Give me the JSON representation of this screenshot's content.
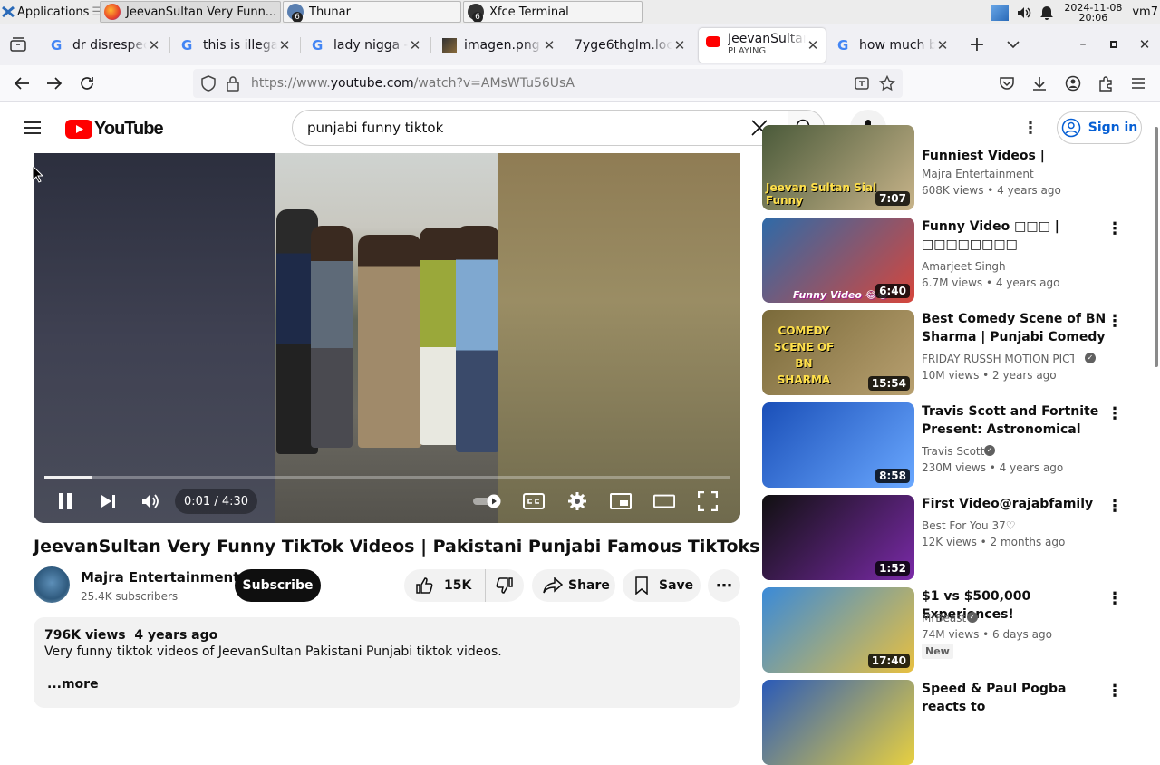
{
  "taskbar": {
    "apps_label": "Applications",
    "windows": [
      "JeevanSultan Very Funn...",
      "Thunar",
      "Xfce Terminal"
    ],
    "badge_thunar": "6",
    "badge_terminal": "6",
    "date": "2024-11-08",
    "time": "20:06",
    "user": "vm7"
  },
  "tabs": [
    {
      "title": "dr disrespect"
    },
    {
      "title": "this is illegal"
    },
    {
      "title": "lady nigga -"
    },
    {
      "title": "imagen.png"
    },
    {
      "title": "7yge6thglm.loc"
    },
    {
      "title": "JeevanSultan",
      "status": "PLAYING"
    },
    {
      "title": "how much b"
    }
  ],
  "url": {
    "prefix": "https://www.",
    "host": "youtube.com",
    "path": "/watch?v=AMsWTu56UsA"
  },
  "youtube": {
    "logo_text": "YouTube",
    "search_value": "punjabi funny tiktok",
    "signin": "Sign in"
  },
  "player": {
    "time": "0:01 / 4:30",
    "progress": 0.07
  },
  "video": {
    "title": "JeevanSultan Very Funny TikTok Videos | Pakistani Punjabi Famous TikToks",
    "channel": "Majra Entertainment",
    "subscribers": "25.4K subscribers",
    "subscribe": "Subscribe",
    "likes": "15K",
    "share": "Share",
    "save": "Save",
    "views": "796K views",
    "age": "4 years ago",
    "description": "Very funny tiktok videos of JeevanSultan Pakistani Punjabi tiktok videos.",
    "more": "...more"
  },
  "recommendations": [
    {
      "title": "Funniest Videos | Pakistani...",
      "channel": "Majra Entertainment",
      "meta": "608K views • 4 years ago",
      "duration": "7:07",
      "thumb_text": "Jeevan Sultan Sial Funny",
      "colors": [
        "#4a5a3a",
        "#c8b48a"
      ]
    },
    {
      "title": "Funny Video □□□ | □□□□□□□□",
      "channel": "Amarjeet Singh",
      "meta": "6.7M views • 4 years ago",
      "duration": "6:40",
      "thumb_text": "Funny Video 😂😂",
      "colors": [
        "#2e6aa8",
        "#d6463c"
      ]
    },
    {
      "title": "Best Comedy Scene of BN Sharma | Punjabi Comedy Clip...",
      "channel": "FRIDAY RUSSH MOTION PICTU...",
      "meta": "10M views • 2 years ago",
      "duration": "15:54",
      "thumb_text": "COMEDY SCENE OF BN SHARMA",
      "colors": [
        "#7a6a3a",
        "#b8a070"
      ],
      "verified": true
    },
    {
      "title": "Travis Scott and Fortnite Present: Astronomical (Full...",
      "channel": "Travis Scott",
      "meta": "230M views • 4 years ago",
      "duration": "8:58",
      "thumb_text": "",
      "colors": [
        "#1a4fb8",
        "#6aa8ff"
      ],
      "verified": true
    },
    {
      "title": "First Video@rajabfamily",
      "channel": "Best For You 37♡",
      "meta": "12K views • 2 months ago",
      "duration": "1:52",
      "thumb_text": "",
      "colors": [
        "#101010",
        "#7a2aa8"
      ]
    },
    {
      "title": "$1 vs $500,000 Experiences!",
      "channel": "MrBeast",
      "meta": "74M views • 6 days ago",
      "duration": "17:40",
      "thumb_text": "",
      "colors": [
        "#3a8ad8",
        "#e8c040"
      ],
      "verified": true,
      "badge": "New"
    },
    {
      "title": "Speed & Paul Pogba reacts to",
      "channel": "",
      "meta": "",
      "duration": "",
      "thumb_text": "",
      "colors": [
        "#2a5ab8",
        "#e8d040"
      ]
    }
  ]
}
